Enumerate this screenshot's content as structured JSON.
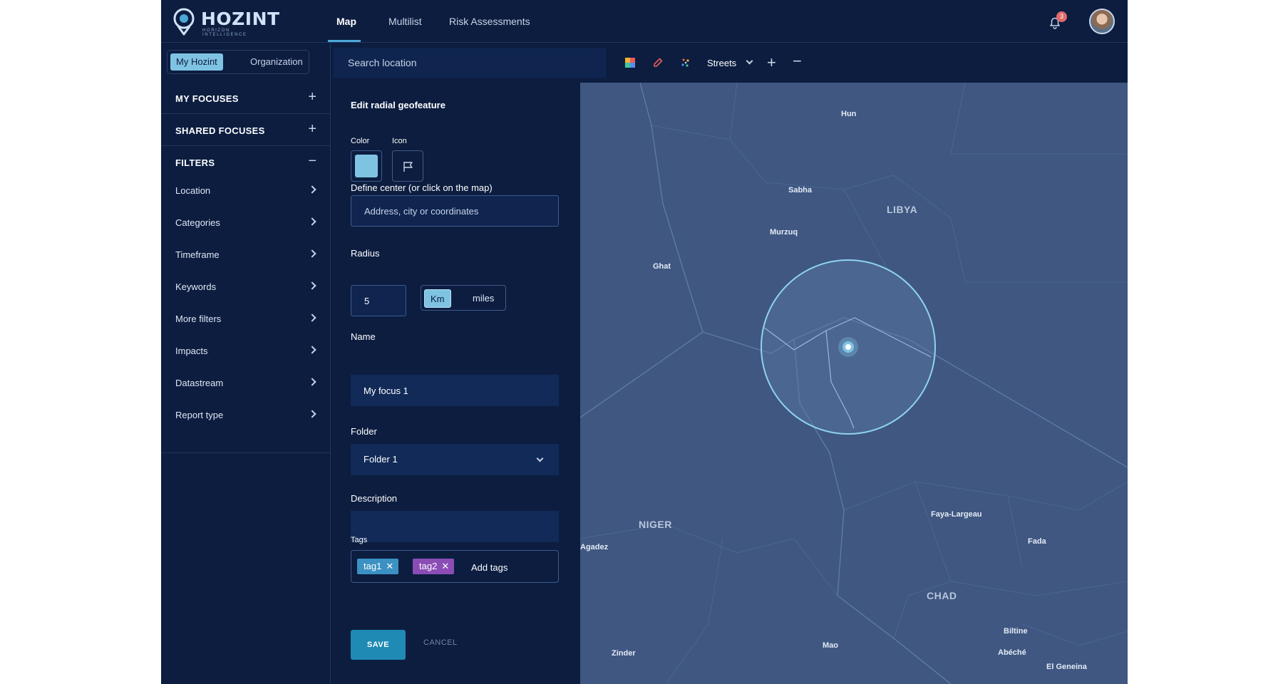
{
  "brand": {
    "name": "HOZINT",
    "tagline": "HORIZON INTELLIGENCE"
  },
  "nav": {
    "tabs": [
      {
        "label": "Map"
      },
      {
        "label": "Multilist"
      },
      {
        "label": "Risk Assessments"
      }
    ]
  },
  "notifications": {
    "count": "3"
  },
  "sidebar": {
    "scope": {
      "mine": "My Hozint",
      "org": "Organization"
    },
    "sections": [
      {
        "label": "MY FOCUSES"
      },
      {
        "label": "SHARED FOCUSES"
      },
      {
        "label": "FILTERS"
      }
    ],
    "filters": [
      "Location",
      "Categories",
      "Timeframe",
      "Keywords",
      "More filters",
      "Impacts",
      "Datastream",
      "Report type"
    ]
  },
  "toolbar": {
    "search_placeholder": "Search location",
    "layer": "Streets"
  },
  "form": {
    "title": "Edit radial geofeature",
    "color_label": "Color",
    "icon_label": "Icon",
    "center_label": "Define center (or click on the map)",
    "center_placeholder": "Address, city or coordinates",
    "radius_label": "Radius",
    "radius_value": "5",
    "units": [
      "Km",
      "miles"
    ],
    "name_label": "Name",
    "name_value": "My focus 1",
    "folder_label": "Folder",
    "folder_value": "Folder 1",
    "description_label": "Description",
    "tags_label": "Tags",
    "tags": [
      "tag1",
      "tag2"
    ],
    "tag_remove": "✕",
    "tags_placeholder": "Add tags",
    "save": "SAVE",
    "cancel": "CANCEL"
  },
  "colors": {
    "accent": "#7fc3e3",
    "tag1": "#3a91c2",
    "tag2": "#8b4db5",
    "save": "#1f8ab4"
  },
  "map": {
    "places": [
      "Hun",
      "Sabha",
      "Murzuq",
      "Ghat",
      "Agadez",
      "Faya-Largeau",
      "Fada",
      "Biltine",
      "Abéché",
      "El Geneina",
      "Zinder",
      "Mao"
    ],
    "countries": [
      "LIBYA",
      "NIGER",
      "CHAD"
    ]
  }
}
